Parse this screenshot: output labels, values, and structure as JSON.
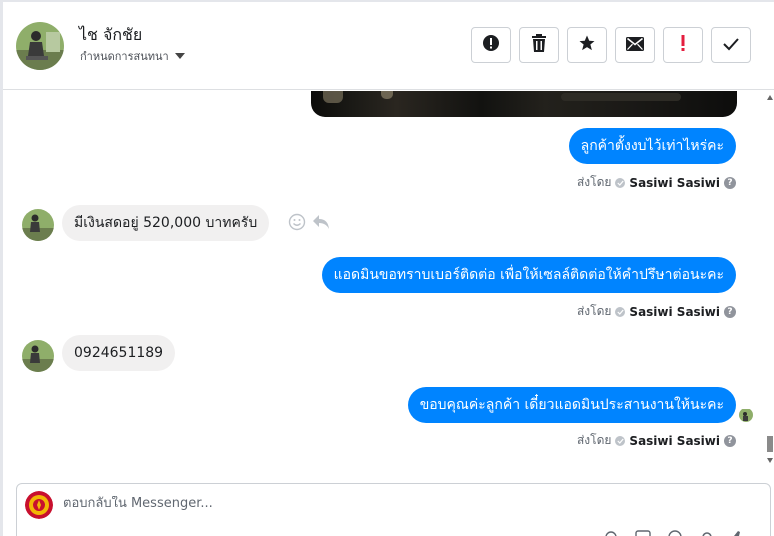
{
  "header": {
    "contact_name": "ไช จักชัย",
    "assign_label": "กำหนดการสนทนา",
    "actions": [
      {
        "name": "mark-spam-button",
        "icon": "exclamation-circle-icon"
      },
      {
        "name": "delete-button",
        "icon": "trash-icon"
      },
      {
        "name": "star-button",
        "icon": "star-icon"
      },
      {
        "name": "mark-unread-button",
        "icon": "envelope-icon"
      },
      {
        "name": "follow-up-button",
        "icon": "exclamation-red-icon",
        "text": "!"
      },
      {
        "name": "mark-done-button",
        "icon": "check-icon"
      }
    ]
  },
  "thread": {
    "messages": [
      {
        "from": "page",
        "text": "ลูกค้าตั้งงบไว้เท่าไหร่คะ"
      },
      {
        "from": "customer",
        "text": "มีเงินสดอยู่ 520,000 บาทครับ"
      },
      {
        "from": "page",
        "text": "แอดมินขอทราบเบอร์ติดต่อ เพื่อให้เซลล์ติดต่อให้คำปรึษาต่อนะคะ"
      },
      {
        "from": "customer",
        "text": "0924651189"
      },
      {
        "from": "page",
        "text": "ขอบคุณค่ะลูกค้า เดี๋ยวแอดมินประสานงานให้นะคะ"
      }
    ],
    "sent_by_label": "ส่งโดย",
    "sender_name": "Sasiwi Sasiwi",
    "help_glyph": "?"
  },
  "composer": {
    "placeholder": "ตอบกลับใน Messenger..."
  },
  "colors": {
    "outgoing_bubble": "#0084ff",
    "incoming_bubble": "#f1f0f0",
    "follow_up_red": "#e41e3f"
  }
}
